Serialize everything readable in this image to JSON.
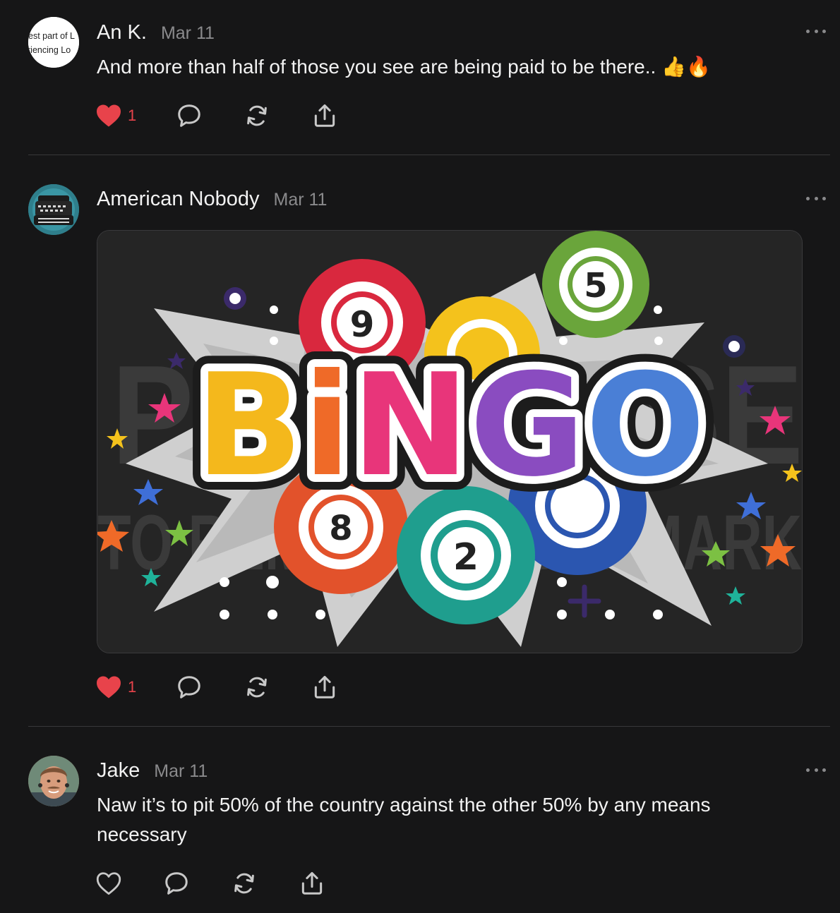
{
  "posts": [
    {
      "author": "An K.",
      "date": "Mar 11",
      "avatar_text": [
        "est part of L",
        "riencing Lo"
      ],
      "text": "And more than half of those you see are being paid to be there.. 👍🔥",
      "likes": "1",
      "liked": true,
      "icons": [
        "heart-icon",
        "comment-icon",
        "repost-icon",
        "share-icon",
        "more-icon"
      ]
    },
    {
      "author": "American Nobody",
      "date": "Mar 11",
      "likes": "1",
      "liked": true,
      "image": {
        "word": "BiNGO",
        "ball_numbers": [
          "5",
          "9",
          "8",
          "2"
        ],
        "watermark": [
          "PURCHASE",
          "TO REMOVE WATERMARK"
        ]
      }
    },
    {
      "author": "Jake",
      "date": "Mar 11",
      "text": "Naw it’s to pit 50% of the country against the other 50% by any means necessary",
      "liked": false
    }
  ],
  "colors": {
    "background": "#161617",
    "like_red": "#e8434b",
    "muted": "#8a8a8c",
    "divider": "#38383a"
  }
}
